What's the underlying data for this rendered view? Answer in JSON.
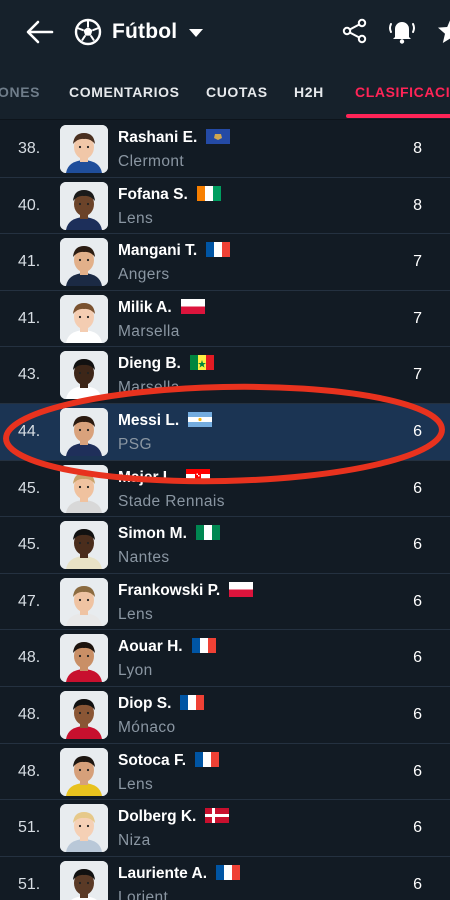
{
  "header": {
    "back_icon": "arrow-left-icon",
    "sport_icon": "soccer-ball-icon",
    "sport_label": "Fútbol",
    "share_icon": "share-icon",
    "alert_icon": "bell-alert-icon",
    "star_icon": "star-icon"
  },
  "tabs": [
    {
      "label": "ONES"
    },
    {
      "label": "COMENTARIOS"
    },
    {
      "label": "CUOTAS"
    },
    {
      "label": "H2H"
    },
    {
      "label": "CLASIFICACIO"
    }
  ],
  "colors": {
    "accent": "#ff2457",
    "highlight_row": "#1b3453",
    "background": "#121b24",
    "annotation": "#e8321e"
  },
  "rows": [
    {
      "rank": "38.",
      "name": "Rashani E.",
      "club": "Clermont",
      "goals": "8",
      "flag": "kosovo"
    },
    {
      "rank": "40.",
      "name": "Fofana S.",
      "club": "Lens",
      "goals": "8",
      "flag": "ivory-coast"
    },
    {
      "rank": "41.",
      "name": "Mangani T.",
      "club": "Angers",
      "goals": "7",
      "flag": "france"
    },
    {
      "rank": "41.",
      "name": "Milik A.",
      "club": "Marsella",
      "goals": "7",
      "flag": "poland"
    },
    {
      "rank": "43.",
      "name": "Dieng B.",
      "club": "Marsella",
      "goals": "7",
      "flag": "senegal"
    },
    {
      "rank": "44.",
      "name": "Messi L.",
      "club": "PSG",
      "goals": "6",
      "flag": "argentina",
      "highlighted": true
    },
    {
      "rank": "45.",
      "name": "Majer L.",
      "club": "Stade Rennais",
      "goals": "6",
      "flag": "croatia"
    },
    {
      "rank": "45.",
      "name": "Simon M.",
      "club": "Nantes",
      "goals": "6",
      "flag": "nigeria"
    },
    {
      "rank": "47.",
      "name": "Frankowski P.",
      "club": "Lens",
      "goals": "6",
      "flag": "poland"
    },
    {
      "rank": "48.",
      "name": "Aouar H.",
      "club": "Lyon",
      "goals": "6",
      "flag": "france"
    },
    {
      "rank": "48.",
      "name": "Diop S.",
      "club": "Mónaco",
      "goals": "6",
      "flag": "france"
    },
    {
      "rank": "48.",
      "name": "Sotoca F.",
      "club": "Lens",
      "goals": "6",
      "flag": "france"
    },
    {
      "rank": "51.",
      "name": "Dolberg K.",
      "club": "Niza",
      "goals": "6",
      "flag": "denmark"
    },
    {
      "rank": "51.",
      "name": "Lauriente A.",
      "club": "Lorient",
      "goals": "6",
      "flag": "france"
    }
  ]
}
